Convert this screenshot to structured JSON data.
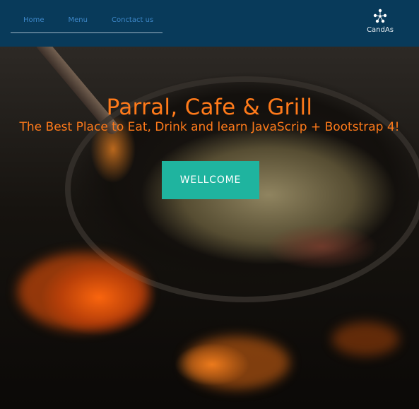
{
  "header": {
    "nav_links": [
      "Home",
      "Menu",
      "Conctact us"
    ],
    "brand": {
      "name": "CandAs",
      "icon": "molecule-logo-icon"
    }
  },
  "hero": {
    "title": "Parral, Cafe & Grill",
    "subtitle": "The Best Place to Eat, Drink and learn JavaScrip + Bootstrap 4!",
    "button_label": "WELLCOME",
    "background_image": "wok-cooking-on-fire"
  },
  "colors": {
    "header_background": "#083a5a",
    "nav_link": "#3d86c7",
    "title": "#ff7a1a",
    "button": "#1fb49f"
  }
}
